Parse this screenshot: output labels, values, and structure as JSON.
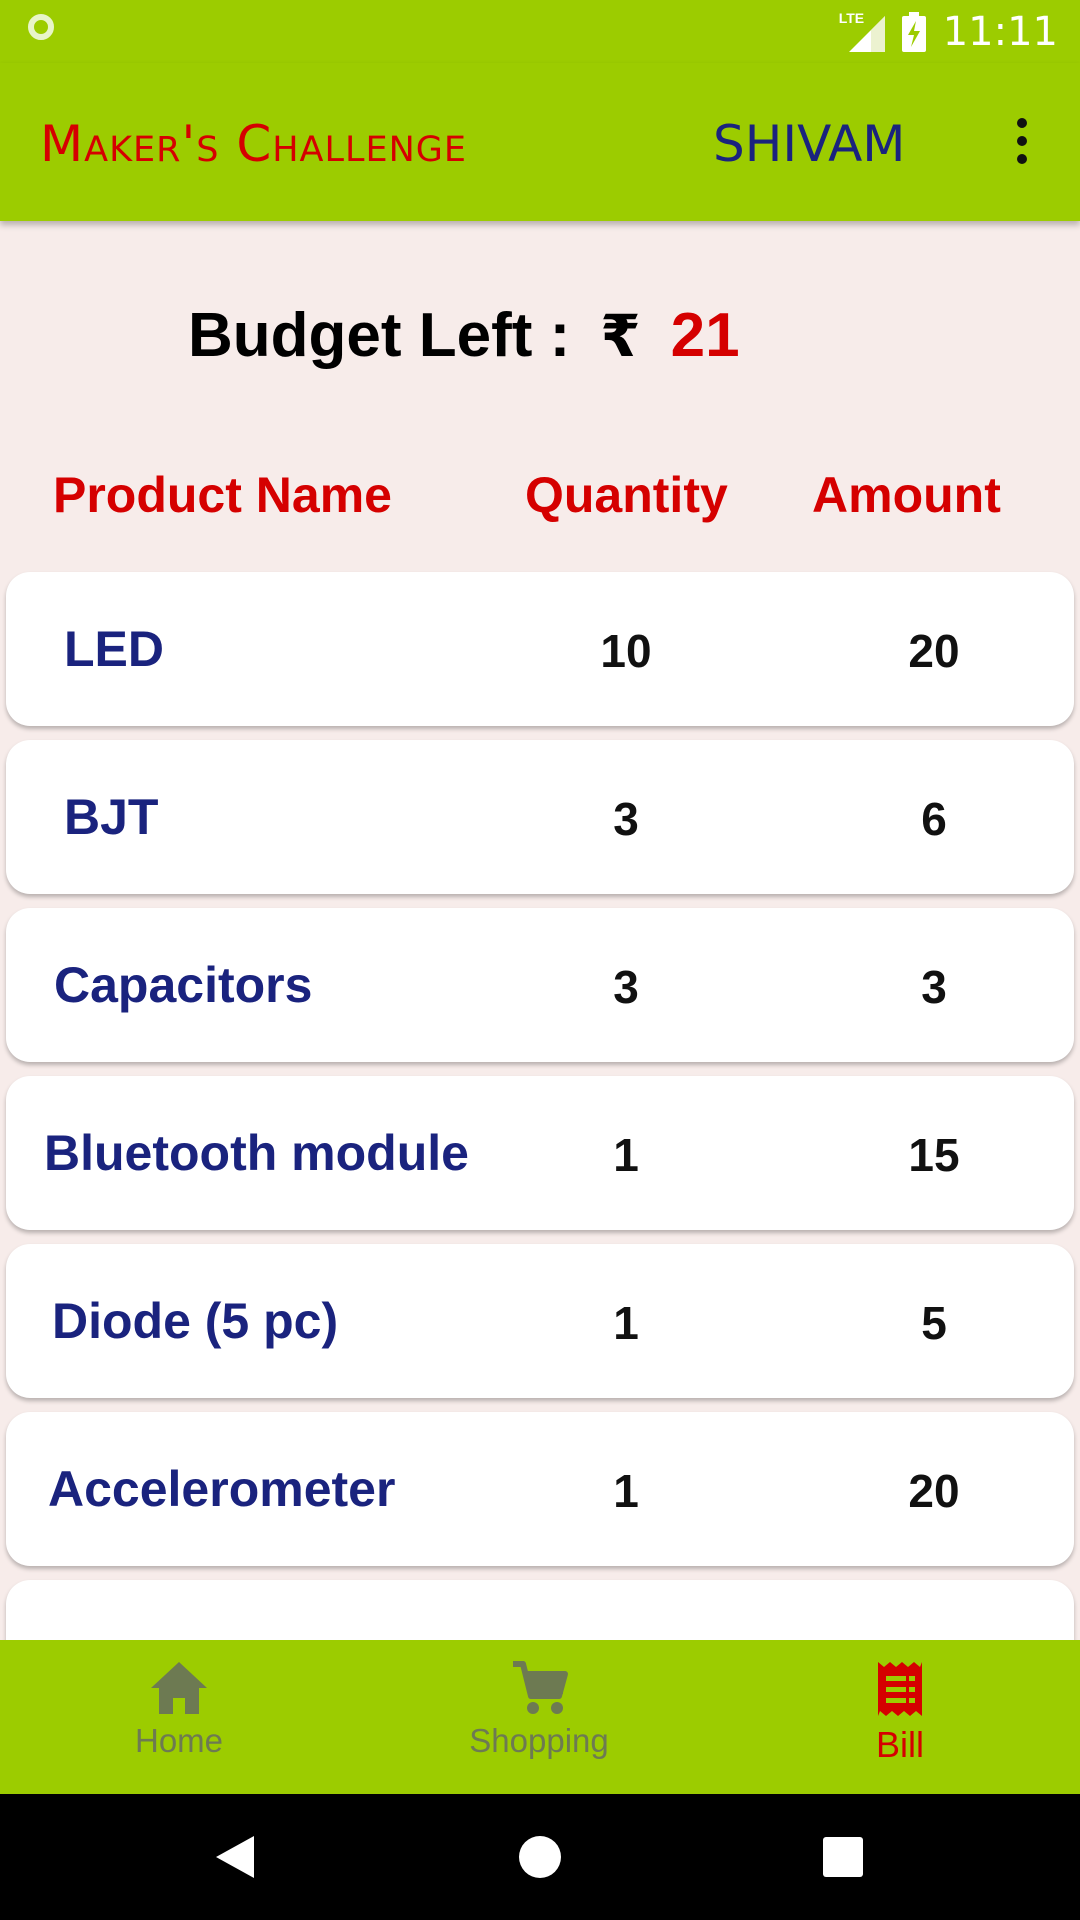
{
  "status_bar": {
    "network_label": "LTE",
    "time": "11:11"
  },
  "app_bar": {
    "title": "Maker's Challenge",
    "user": "SHIVAM",
    "menu_icon": "more-vert-icon"
  },
  "budget": {
    "label": "Budget Left :",
    "currency": "₹",
    "amount": "21"
  },
  "table": {
    "headers": {
      "product": "Product Name",
      "quantity": "Quantity",
      "amount": "Amount"
    },
    "rows": [
      {
        "name": "LED",
        "quantity": "10",
        "amount": "20"
      },
      {
        "name": "BJT",
        "quantity": "3",
        "amount": "6"
      },
      {
        "name": "Capacitors",
        "quantity": "3",
        "amount": "3"
      },
      {
        "name": "Bluetooth module",
        "quantity": "1",
        "amount": "15"
      },
      {
        "name": "Diode (5 pc)",
        "quantity": "1",
        "amount": "5"
      },
      {
        "name": "Accelerometer",
        "quantity": "1",
        "amount": "20"
      }
    ]
  },
  "bottom_nav": {
    "items": [
      {
        "label": "Home",
        "icon": "home-icon"
      },
      {
        "label": "Shopping",
        "icon": "cart-icon"
      },
      {
        "label": "Bill",
        "icon": "receipt-icon",
        "active": true
      }
    ],
    "active_color": "#d50000",
    "inactive_color": "#6d7a52"
  },
  "colors": {
    "brand_green": "#9ccc00",
    "accent_red": "#d50000",
    "navy": "#1a237e"
  }
}
